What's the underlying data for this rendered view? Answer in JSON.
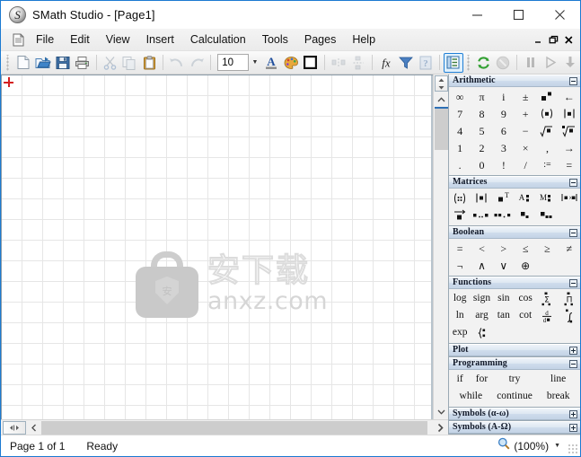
{
  "window": {
    "title": "SMath Studio - [Page1]",
    "app_icon": "smath-logo-icon",
    "minimize": "minimize-icon",
    "maximize": "maximize-icon",
    "close": "close-icon"
  },
  "menubar": {
    "doc_icon": "document-icon",
    "items": [
      {
        "label": "File"
      },
      {
        "label": "Edit"
      },
      {
        "label": "View"
      },
      {
        "label": "Insert"
      },
      {
        "label": "Calculation"
      },
      {
        "label": "Tools"
      },
      {
        "label": "Pages"
      },
      {
        "label": "Help"
      }
    ],
    "mdi": {
      "minimize": "mdi-minimize-icon",
      "restore": "mdi-restore-icon",
      "close": "mdi-close-icon"
    }
  },
  "toolbar": {
    "font_size_value": "10",
    "buttons": [
      {
        "name": "new-document-button",
        "icon": "new-page-icon"
      },
      {
        "name": "open-document-button",
        "icon": "open-folder-icon"
      },
      {
        "name": "save-document-button",
        "icon": "floppy-disk-icon"
      },
      {
        "name": "print-button",
        "icon": "printer-icon"
      },
      {
        "name": "cut-button",
        "icon": "scissors-icon"
      },
      {
        "name": "copy-button",
        "icon": "copy-icon"
      },
      {
        "name": "paste-button",
        "icon": "clipboard-icon"
      },
      {
        "name": "undo-button",
        "icon": "undo-arrow-icon"
      },
      {
        "name": "redo-button",
        "icon": "redo-arrow-icon"
      },
      {
        "name": "font-color-button",
        "icon": "letter-a-icon"
      },
      {
        "name": "background-color-button",
        "icon": "palette-icon"
      },
      {
        "name": "border-button",
        "icon": "square-border-icon"
      },
      {
        "name": "align-horizontal-button",
        "icon": "align-horizontal-icon"
      },
      {
        "name": "align-vertical-button",
        "icon": "align-vertical-icon"
      },
      {
        "name": "insert-function-button",
        "icon": "fx-icon"
      },
      {
        "name": "filter-button",
        "icon": "funnel-icon"
      },
      {
        "name": "help-reference-button",
        "icon": "blue-book-question-icon"
      },
      {
        "name": "side-panel-toggle-button",
        "icon": "side-panel-icon"
      },
      {
        "name": "recalculate-button",
        "icon": "green-refresh-icon"
      },
      {
        "name": "stop-button",
        "icon": "gray-stop-icon"
      },
      {
        "name": "pause-button",
        "icon": "pause-icon"
      },
      {
        "name": "run-button",
        "icon": "play-icon"
      },
      {
        "name": "step-button",
        "icon": "step-down-icon"
      }
    ]
  },
  "canvas": {
    "cursor": "red-crosshair-cursor",
    "watermark": {
      "logo": "briefcase-shield-logo",
      "shield_char": "安",
      "chinese_text": "安下载",
      "url_text": "anxz.com"
    }
  },
  "side_panels": [
    {
      "id": "arithmetic",
      "title": "Arithmetic",
      "collapsed": false,
      "rows": [
        [
          "∞",
          "π",
          "i",
          "±",
          "▪▪",
          "←"
        ],
        [
          "7",
          "8",
          "9",
          "+",
          "(▪)",
          "|▪|"
        ],
        [
          "4",
          "5",
          "6",
          "−",
          "√▪",
          "ⁿ√▪"
        ],
        [
          "1",
          "2",
          "3",
          "×",
          ",",
          "→"
        ],
        [
          ".",
          "0",
          "!",
          "/",
          ":=",
          "="
        ]
      ]
    },
    {
      "id": "matrices",
      "title": "Matrices",
      "collapsed": false,
      "rows": [
        [
          "(::)",
          "|▪|",
          "▪ᵀ",
          "A▪",
          "M▪",
          "ᵢ▪ᵢ"
        ],
        [
          "▪⃗",
          "▪..▪",
          "▪▪.▪",
          "▪₊",
          "▪₊₊",
          ""
        ]
      ]
    },
    {
      "id": "boolean",
      "title": "Boolean",
      "collapsed": false,
      "rows": [
        [
          "=",
          "<",
          ">",
          "≤",
          "≥",
          "≠"
        ],
        [
          "¬",
          "∧",
          "∨",
          "⊕",
          "",
          ""
        ]
      ]
    },
    {
      "id": "functions",
      "title": "Functions",
      "collapsed": false,
      "rows": [
        [
          "log",
          "sign",
          "sin",
          "cos",
          "Σ",
          "Π"
        ],
        [
          "ln",
          "arg",
          "tan",
          "cot",
          "d/d▪",
          "∫"
        ],
        [
          "exp",
          "(|",
          "",
          "",
          "",
          ""
        ]
      ]
    },
    {
      "id": "plot",
      "title": "Plot",
      "collapsed": true,
      "rows": []
    },
    {
      "id": "programming",
      "title": "Programming",
      "collapsed": false,
      "rows": [
        [
          "if",
          "for",
          "try",
          "line"
        ],
        [
          "while",
          "continue",
          "break"
        ]
      ]
    },
    {
      "id": "symbols-greek-lower",
      "title": "Symbols (α-ω)",
      "collapsed": true,
      "rows": []
    },
    {
      "id": "symbols-greek-upper",
      "title": "Symbols (Α-Ω)",
      "collapsed": true,
      "rows": []
    }
  ],
  "statusbar": {
    "page_info": "Page 1 of 1",
    "status": "Ready",
    "zoom_icon": "magnifier-icon",
    "zoom_level": "(100%)"
  }
}
